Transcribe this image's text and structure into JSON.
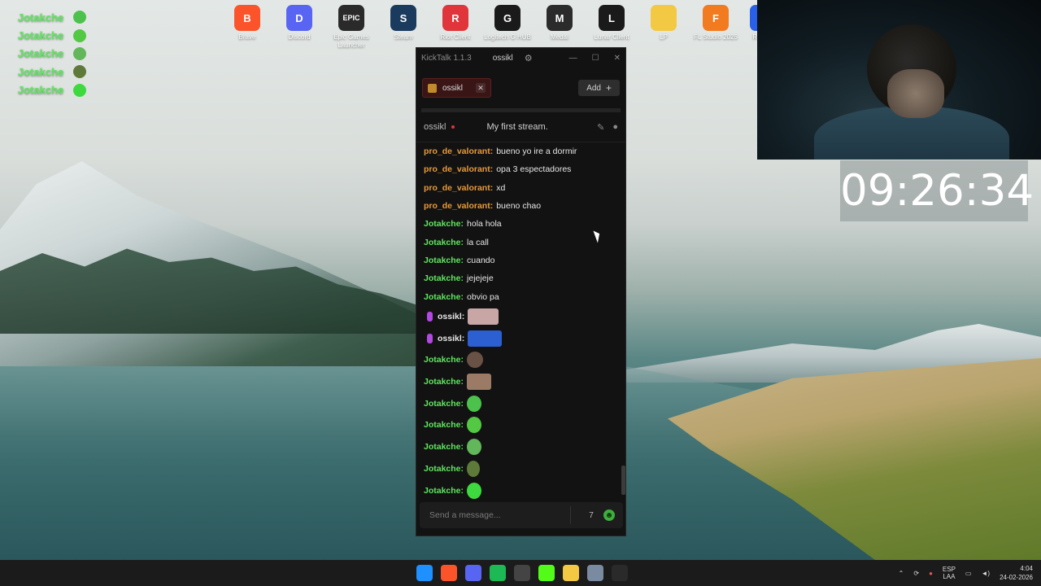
{
  "desktop_icons": [
    {
      "label": "Brave",
      "glyph": "B",
      "color": "#fb542b"
    },
    {
      "label": "Discord",
      "glyph": "D",
      "color": "#5865f2"
    },
    {
      "label": "Epic Games Launcher",
      "glyph": "EPIC",
      "color": "#2a2a2a"
    },
    {
      "label": "Steam",
      "glyph": "S",
      "color": "#1b3b5e"
    },
    {
      "label": "Riot Client",
      "glyph": "R",
      "color": "#e0353b"
    },
    {
      "label": "Logitech G HUB",
      "glyph": "G",
      "color": "#1a1a1a"
    },
    {
      "label": "Medal",
      "glyph": "M",
      "color": "#2b2b2b"
    },
    {
      "label": "Lunar Client",
      "glyph": "L",
      "color": "#1a1a1a"
    },
    {
      "label": "LP",
      "glyph": "",
      "color": "#f3c843"
    },
    {
      "label": "FL Studio 2025",
      "glyph": "F",
      "color": "#f27b20"
    },
    {
      "label": "Roblox",
      "glyph": "R",
      "color": "#2a60e8"
    }
  ],
  "overlay": {
    "rows": [
      {
        "name": "Jotakche",
        "emote": "crewmate-emote-icon",
        "emote_color": "#4cc24c"
      },
      {
        "name": "Jotakche",
        "emote": "smile-emote-icon",
        "emote_color": "#53c843"
      },
      {
        "name": "Jotakche",
        "emote": "skull-emote-icon",
        "emote_color": "#62b75a"
      },
      {
        "name": "Jotakche",
        "emote": "frog-emote-icon",
        "emote_color": "#5d7a3a"
      },
      {
        "name": "Jotakche",
        "emote": "ghost-emote-icon",
        "emote_color": "#3ed93e"
      }
    ]
  },
  "clock": "09:26:34",
  "kicktalk": {
    "app_title": "KickTalk 1.1.3",
    "channel": "ossikl",
    "tab_label": "ossikl",
    "add_label": "Add",
    "stream_name": "ossikl",
    "stream_title": "My first stream.",
    "input_placeholder": "Send a message...",
    "messages": [
      {
        "user": "pro_de_valorant:",
        "color": "orange",
        "text": "bueno yo ire a dormir"
      },
      {
        "user": "pro_de_valorant:",
        "color": "orange",
        "text": "opa 3 espectadores"
      },
      {
        "user": "pro_de_valorant:",
        "color": "orange",
        "text": "xd"
      },
      {
        "user": "pro_de_valorant:",
        "color": "orange",
        "text": "bueno chao"
      },
      {
        "user": "Jotakche:",
        "color": "green",
        "text": "hola hola"
      },
      {
        "user": "Jotakche:",
        "color": "green",
        "text": "la call"
      },
      {
        "user": "Jotakche:",
        "color": "green",
        "text": "cuando"
      },
      {
        "user": "Jotakche:",
        "color": "green",
        "text": "jejejeje"
      },
      {
        "user": "Jotakche:",
        "color": "green",
        "text": "obvio pa"
      }
    ],
    "emote_messages": [
      {
        "user": "ossikl:",
        "color": "white",
        "mic": true,
        "emote": "photo-emote-icon",
        "emote_color": "#c9a6a6",
        "w": 38
      },
      {
        "user": "ossikl:",
        "color": "white",
        "mic": true,
        "emote": "car-emote-icon",
        "emote_color": "#2c5fd1",
        "w": 42
      },
      {
        "user": "Jotakche:",
        "color": "green",
        "mic": false,
        "emote": "face-emote-icon",
        "emote_color": "#6a5145",
        "w": 20
      },
      {
        "user": "Jotakche:",
        "color": "green",
        "mic": false,
        "emote": "face2-emote-icon",
        "emote_color": "#9b7a66",
        "w": 30
      },
      {
        "user": "Jotakche:",
        "color": "green",
        "mic": false,
        "emote": "crewmate-emote-icon",
        "emote_color": "#4cc24c",
        "w": 18
      },
      {
        "user": "Jotakche:",
        "color": "green",
        "mic": false,
        "emote": "smile-emote-icon",
        "emote_color": "#53c843",
        "w": 18
      },
      {
        "user": "Jotakche:",
        "color": "green",
        "mic": false,
        "emote": "skull-emote-icon",
        "emote_color": "#62b75a",
        "w": 18
      },
      {
        "user": "Jotakche:",
        "color": "green",
        "mic": false,
        "emote": "frog-emote-icon",
        "emote_color": "#5d7a3a",
        "w": 16
      },
      {
        "user": "Jotakche:",
        "color": "green",
        "mic": false,
        "emote": "ghost-emote-icon",
        "emote_color": "#3ed93e",
        "w": 18
      }
    ]
  },
  "taskbar": {
    "apps": [
      {
        "name": "windows-start-icon",
        "color": "#1e90ff"
      },
      {
        "name": "brave-icon",
        "color": "#fb542b"
      },
      {
        "name": "discord-icon",
        "color": "#5865f2"
      },
      {
        "name": "spotify-icon",
        "color": "#1db954"
      },
      {
        "name": "obs-icon",
        "color": "#444444"
      },
      {
        "name": "kick-icon",
        "color": "#53fc18"
      },
      {
        "name": "file-explorer-icon",
        "color": "#f3c843"
      },
      {
        "name": "settings-icon",
        "color": "#7a8aa0"
      },
      {
        "name": "kicktalk-icon",
        "color": "#2a2a2a"
      }
    ],
    "lang_top": "ESP",
    "lang_bottom": "LAA",
    "time": "4:04",
    "date": "24-02-2026"
  }
}
